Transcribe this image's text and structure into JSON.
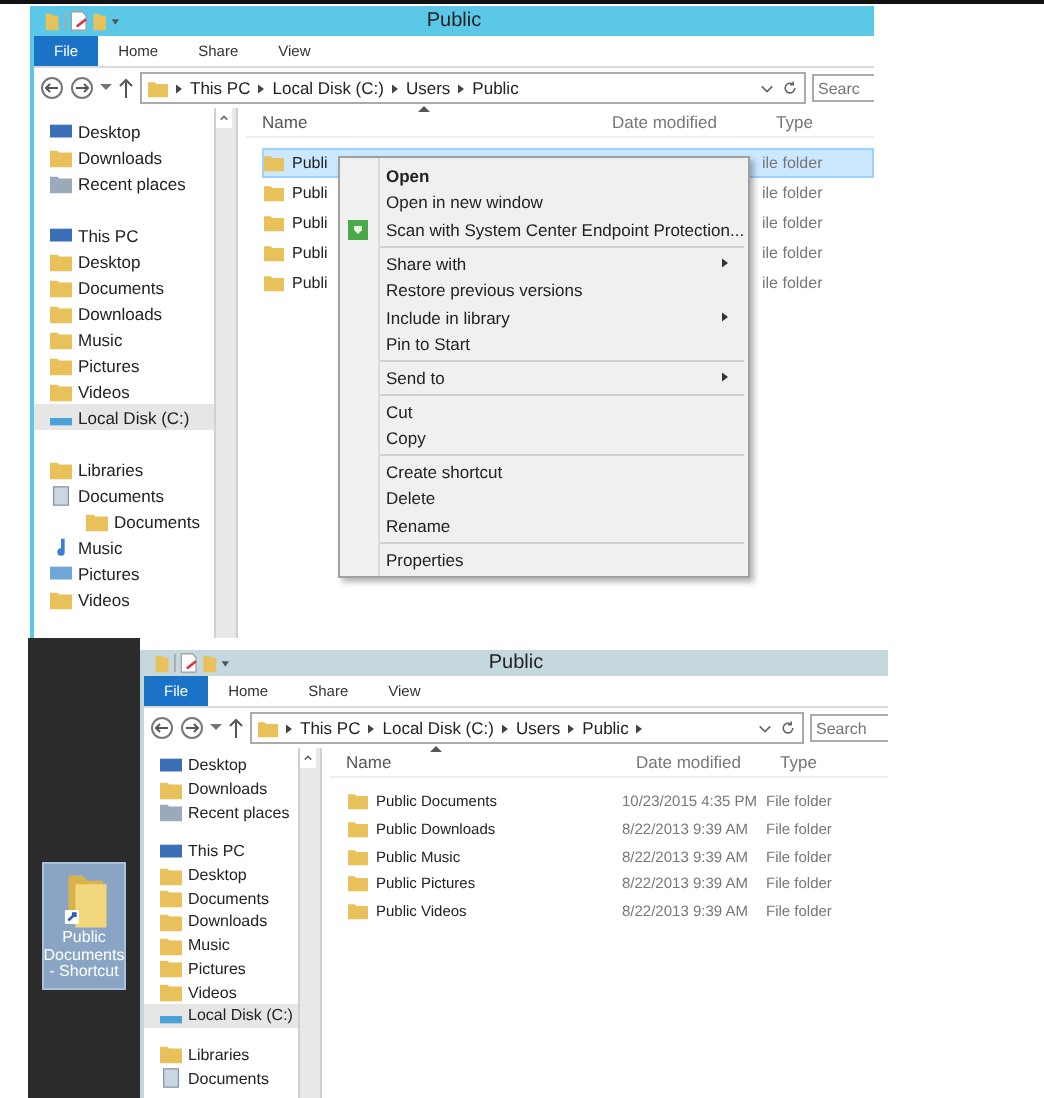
{
  "windows": [
    {
      "title": "Public",
      "active": true,
      "tabs": [
        {
          "label": "File",
          "selected": true
        },
        {
          "label": "Home",
          "selected": false
        },
        {
          "label": "Share",
          "selected": false
        },
        {
          "label": "View",
          "selected": false
        }
      ],
      "address": [
        "This PC",
        "Local Disk (C:)",
        "Users",
        "Public"
      ],
      "address_trailing_arrow": false,
      "search": {
        "placeholder": "Searc"
      },
      "nav": [
        {
          "label": "Desktop",
          "kind": "monitor",
          "selected": false
        },
        {
          "label": "Downloads",
          "kind": "folder",
          "selected": false
        },
        {
          "label": "Recent places",
          "kind": "recent",
          "selected": false
        },
        {
          "label": "This PC",
          "kind": "computer",
          "selected": false,
          "children": [
            {
              "label": "Desktop",
              "kind": "folder",
              "selected": false
            },
            {
              "label": "Documents",
              "kind": "folder",
              "selected": false
            },
            {
              "label": "Downloads",
              "kind": "folder",
              "selected": false
            },
            {
              "label": "Music",
              "kind": "folder",
              "selected": false
            },
            {
              "label": "Pictures",
              "kind": "folder",
              "selected": false
            },
            {
              "label": "Videos",
              "kind": "folder",
              "selected": false
            },
            {
              "label": "Local Disk (C:)",
              "kind": "drive",
              "selected": true
            }
          ]
        },
        {
          "label": "Libraries",
          "kind": "library",
          "selected": false,
          "children": [
            {
              "label": "Documents",
              "kind": "doc",
              "selected": false,
              "children": [
                {
                  "label": "Documents",
                  "kind": "folder",
                  "selected": false
                }
              ]
            },
            {
              "label": "Music",
              "kind": "note",
              "selected": false
            },
            {
              "label": "Pictures",
              "kind": "image",
              "selected": false
            },
            {
              "label": "Videos",
              "kind": "folder",
              "selected": false
            }
          ]
        }
      ],
      "columns": [
        "Name",
        "Date modified",
        "Type"
      ],
      "rows": [
        {
          "name": "Publi",
          "date": "",
          "type": "ile folder",
          "selected": true
        },
        {
          "name": "Publi",
          "date": "",
          "type": "ile folder",
          "selected": false
        },
        {
          "name": "Publi",
          "date": "",
          "type": "ile folder",
          "selected": false
        },
        {
          "name": "Publi",
          "date": "",
          "type": "ile folder",
          "selected": false
        },
        {
          "name": "Publi",
          "date": "",
          "type": "ile folder",
          "selected": false
        }
      ],
      "context_menu": [
        {
          "kind": "item",
          "label": "Open",
          "bold": true,
          "submenu": false,
          "shield": false
        },
        {
          "kind": "item",
          "label": "Open in new window",
          "bold": false,
          "submenu": false,
          "shield": false
        },
        {
          "kind": "item",
          "label": "Scan with System Center Endpoint Protection...",
          "bold": false,
          "submenu": false,
          "shield": true
        },
        {
          "kind": "separator"
        },
        {
          "kind": "item",
          "label": "Share with",
          "bold": false,
          "submenu": true,
          "shield": false
        },
        {
          "kind": "item",
          "label": "Restore previous versions",
          "bold": false,
          "submenu": false,
          "shield": false
        },
        {
          "kind": "item",
          "label": "Include in library",
          "bold": false,
          "submenu": true,
          "shield": false
        },
        {
          "kind": "item",
          "label": "Pin to Start",
          "bold": false,
          "submenu": false,
          "shield": false
        },
        {
          "kind": "separator"
        },
        {
          "kind": "item",
          "label": "Send to",
          "bold": false,
          "submenu": true,
          "shield": false
        },
        {
          "kind": "separator"
        },
        {
          "kind": "item",
          "label": "Cut",
          "bold": false,
          "submenu": false,
          "shield": false
        },
        {
          "kind": "item",
          "label": "Copy",
          "bold": false,
          "submenu": false,
          "shield": false
        },
        {
          "kind": "separator"
        },
        {
          "kind": "item",
          "label": "Create shortcut",
          "bold": false,
          "submenu": false,
          "shield": false
        },
        {
          "kind": "item",
          "label": "Delete",
          "bold": false,
          "submenu": false,
          "shield": false
        },
        {
          "kind": "item",
          "label": "Rename",
          "bold": false,
          "submenu": false,
          "shield": false
        },
        {
          "kind": "separator"
        },
        {
          "kind": "item",
          "label": "Properties",
          "bold": false,
          "submenu": false,
          "shield": false
        }
      ]
    },
    {
      "title": "Public",
      "active": false,
      "tabs": [
        {
          "label": "File",
          "selected": true
        },
        {
          "label": "Home",
          "selected": false
        },
        {
          "label": "Share",
          "selected": false
        },
        {
          "label": "View",
          "selected": false
        }
      ],
      "address": [
        "This PC",
        "Local Disk (C:)",
        "Users",
        "Public"
      ],
      "address_trailing_arrow": true,
      "search": {
        "placeholder": "Search"
      },
      "nav": [
        {
          "label": "Desktop",
          "kind": "monitor",
          "selected": false
        },
        {
          "label": "Downloads",
          "kind": "folder",
          "selected": false
        },
        {
          "label": "Recent places",
          "kind": "recent",
          "selected": false
        },
        {
          "label": "This PC",
          "kind": "computer",
          "selected": false,
          "children": [
            {
              "label": "Desktop",
              "kind": "folder",
              "selected": false
            },
            {
              "label": "Documents",
              "kind": "folder",
              "selected": false
            },
            {
              "label": "Downloads",
              "kind": "folder",
              "selected": false
            },
            {
              "label": "Music",
              "kind": "folder",
              "selected": false
            },
            {
              "label": "Pictures",
              "kind": "folder",
              "selected": false
            },
            {
              "label": "Videos",
              "kind": "folder",
              "selected": false
            },
            {
              "label": "Local Disk (C:)",
              "kind": "drive",
              "selected": true
            }
          ]
        },
        {
          "label": "Libraries",
          "kind": "library",
          "selected": false,
          "children": [
            {
              "label": "Documents",
              "kind": "doc",
              "selected": false
            }
          ]
        }
      ],
      "columns": [
        "Name",
        "Date modified",
        "Type"
      ],
      "rows": [
        {
          "name": "Public Documents",
          "date": "10/23/2015 4:35 PM",
          "type": "File folder",
          "selected": false
        },
        {
          "name": "Public Downloads",
          "date": "8/22/2013 9:39 AM",
          "type": "File folder",
          "selected": false
        },
        {
          "name": "Public Music",
          "date": "8/22/2013 9:39 AM",
          "type": "File folder",
          "selected": false
        },
        {
          "name": "Public Pictures",
          "date": "8/22/2013 9:39 AM",
          "type": "File folder",
          "selected": false
        },
        {
          "name": "Public Videos",
          "date": "8/22/2013 9:39 AM",
          "type": "File folder",
          "selected": false
        }
      ]
    }
  ],
  "desktop_icon": {
    "label": "Public Documents - Shortcut",
    "selected": true
  }
}
